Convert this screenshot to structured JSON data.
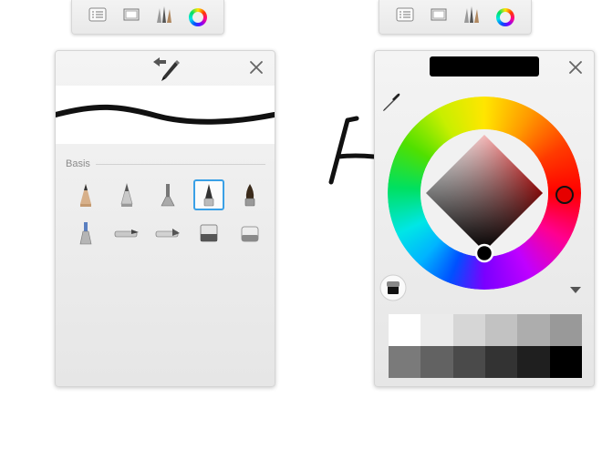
{
  "toolbars": [
    {
      "id": "left",
      "buttons": [
        {
          "name": "layers-icon"
        },
        {
          "name": "canvas-icon"
        },
        {
          "name": "brushes-icon"
        },
        {
          "name": "color-wheel-icon"
        }
      ]
    },
    {
      "id": "right",
      "buttons": [
        {
          "name": "layers-icon"
        },
        {
          "name": "canvas-icon"
        },
        {
          "name": "brushes-icon"
        },
        {
          "name": "color-wheel-icon"
        }
      ]
    }
  ],
  "brush_panel": {
    "section_label": "Basis",
    "selected_index": 3,
    "brushes": [
      {
        "name": "pencil-brush-icon"
      },
      {
        "name": "hard-pencil-brush-icon"
      },
      {
        "name": "airbrush-icon"
      },
      {
        "name": "ballpoint-pen-icon"
      },
      {
        "name": "paintbrush-icon"
      },
      {
        "name": "marker-brush-icon"
      },
      {
        "name": "chisel-marker-icon"
      },
      {
        "name": "wide-marker-icon"
      },
      {
        "name": "hard-eraser-icon"
      },
      {
        "name": "soft-eraser-icon"
      }
    ]
  },
  "color_panel": {
    "current_color": "#000000",
    "selected_hue_color": "#e60000",
    "grays_row1": [
      "#ffffff",
      "#ebebeb",
      "#d6d6d6",
      "#c2c2c2",
      "#adadad",
      "#999999"
    ],
    "grays_row2": [
      "#7a7a7a",
      "#626262",
      "#4a4a4a",
      "#333333",
      "#1f1f1f",
      "#000000"
    ]
  },
  "icons": {
    "close": "close-icon",
    "brush_swap": "brush-swap-icon",
    "eyedropper": "eyedropper-icon",
    "fill": "fill-bucket-icon",
    "expand": "expand-palette-icon"
  }
}
